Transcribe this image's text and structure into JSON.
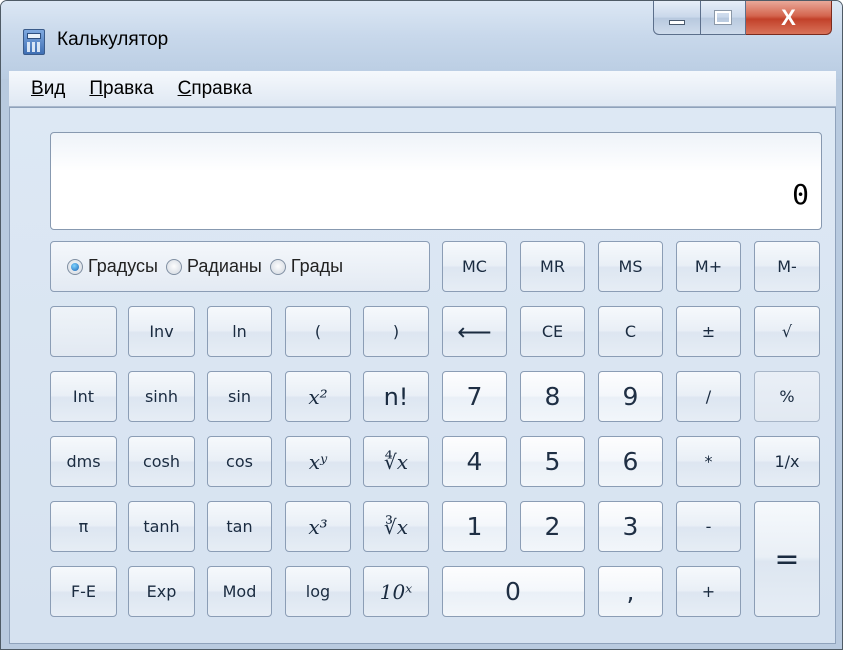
{
  "window": {
    "title": "Калькулятор",
    "close_glyph": "X",
    "icons": [
      "calculator-icon",
      "minimize-icon",
      "maximize-icon",
      "close-icon"
    ]
  },
  "menu": [
    {
      "accel": "В",
      "rest": "ид"
    },
    {
      "accel": "П",
      "rest": "равка"
    },
    {
      "accel": "С",
      "rest": "правка"
    }
  ],
  "display": {
    "value": "0"
  },
  "angle_units": {
    "options": [
      "Градусы",
      "Радианы",
      "Грады"
    ],
    "selected": "Градусы"
  },
  "keys": {
    "mc": "MC",
    "mr": "MR",
    "ms": "MS",
    "mplus": "M+",
    "mminus": "M-",
    "blank": "",
    "inv": "Inv",
    "ln": "ln",
    "lparen": "(",
    "rparen": ")",
    "backspace": "⟵",
    "ce": "CE",
    "c": "C",
    "negate": "±",
    "sqrt": "√",
    "int": "Int",
    "sinh": "sinh",
    "sin": "sin",
    "x2": "x²",
    "fact": "n!",
    "d7": "7",
    "d8": "8",
    "d9": "9",
    "div": "/",
    "percent": "%",
    "dms": "dms",
    "cosh": "cosh",
    "cos": "cos",
    "xy": "xʸ",
    "yroot": "∜x",
    "d4": "4",
    "d5": "5",
    "d6": "6",
    "mul": "*",
    "recip": "1/x",
    "pi": "π",
    "tanh": "tanh",
    "tan": "tan",
    "x3": "x³",
    "cuberoot": "∛x",
    "d1": "1",
    "d2": "2",
    "d3": "3",
    "sub": "-",
    "equals": "=",
    "fe": "F-E",
    "exp": "Exp",
    "mod": "Mod",
    "log": "log",
    "tenx": "10ˣ",
    "d0": "0",
    "dec": ",",
    "add": "+"
  }
}
